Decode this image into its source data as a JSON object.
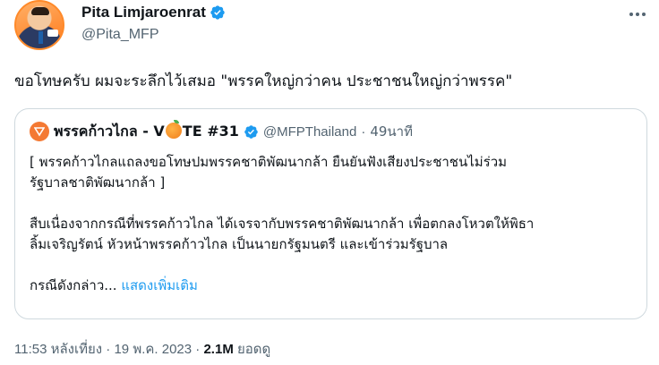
{
  "author": {
    "display_name": "Pita Limjaroenrat",
    "handle": "@Pita_MFP",
    "verified_icon": "verified-badge",
    "verified_color": "#1d9bf0"
  },
  "tweet": {
    "text": "ขอโทษครับ ผมจะระลึกไว้เสมอ \"พรรคใหญ่กว่าคน ประชาชนใหญ่กว่าพรรค\""
  },
  "quoted": {
    "name_before_icon": "พรรคก้าวไกล - V",
    "name_icon": "orange-emoji",
    "name_after_icon": "TE #31",
    "handle": "@MFPThailand",
    "separator": "·",
    "time": "49นาที",
    "avatar_color": "#f47933",
    "lines": [
      "[ พรรคก้าวไกลแถลงขอโทษปมพรรคชาติพัฒนากล้า ยืนยันฟังเสียงประชาชนไม่ร่วม",
      "รัฐบาลชาติพัฒนากล้า ]",
      "สืบเนื่องจากกรณีที่พรรคก้าวไกล ได้เจรจากับพรรคชาติพัฒนากล้า เพื่อตกลงโหวตให้พิธา",
      "ลิ้มเจริญรัตน์ หัวหน้าพรรคก้าวไกล เป็นนายกรัฐมนตรี และเข้าร่วมรัฐบาล",
      "กรณีดังกล่าว..."
    ],
    "show_more": "แสดงเพิ่มเติม"
  },
  "meta": {
    "time": "11:53 หลังเที่ยง",
    "separator": "·",
    "date": "19 พ.ค. 2023",
    "views_count": "2.1M",
    "views_label": "ยอดดู"
  }
}
